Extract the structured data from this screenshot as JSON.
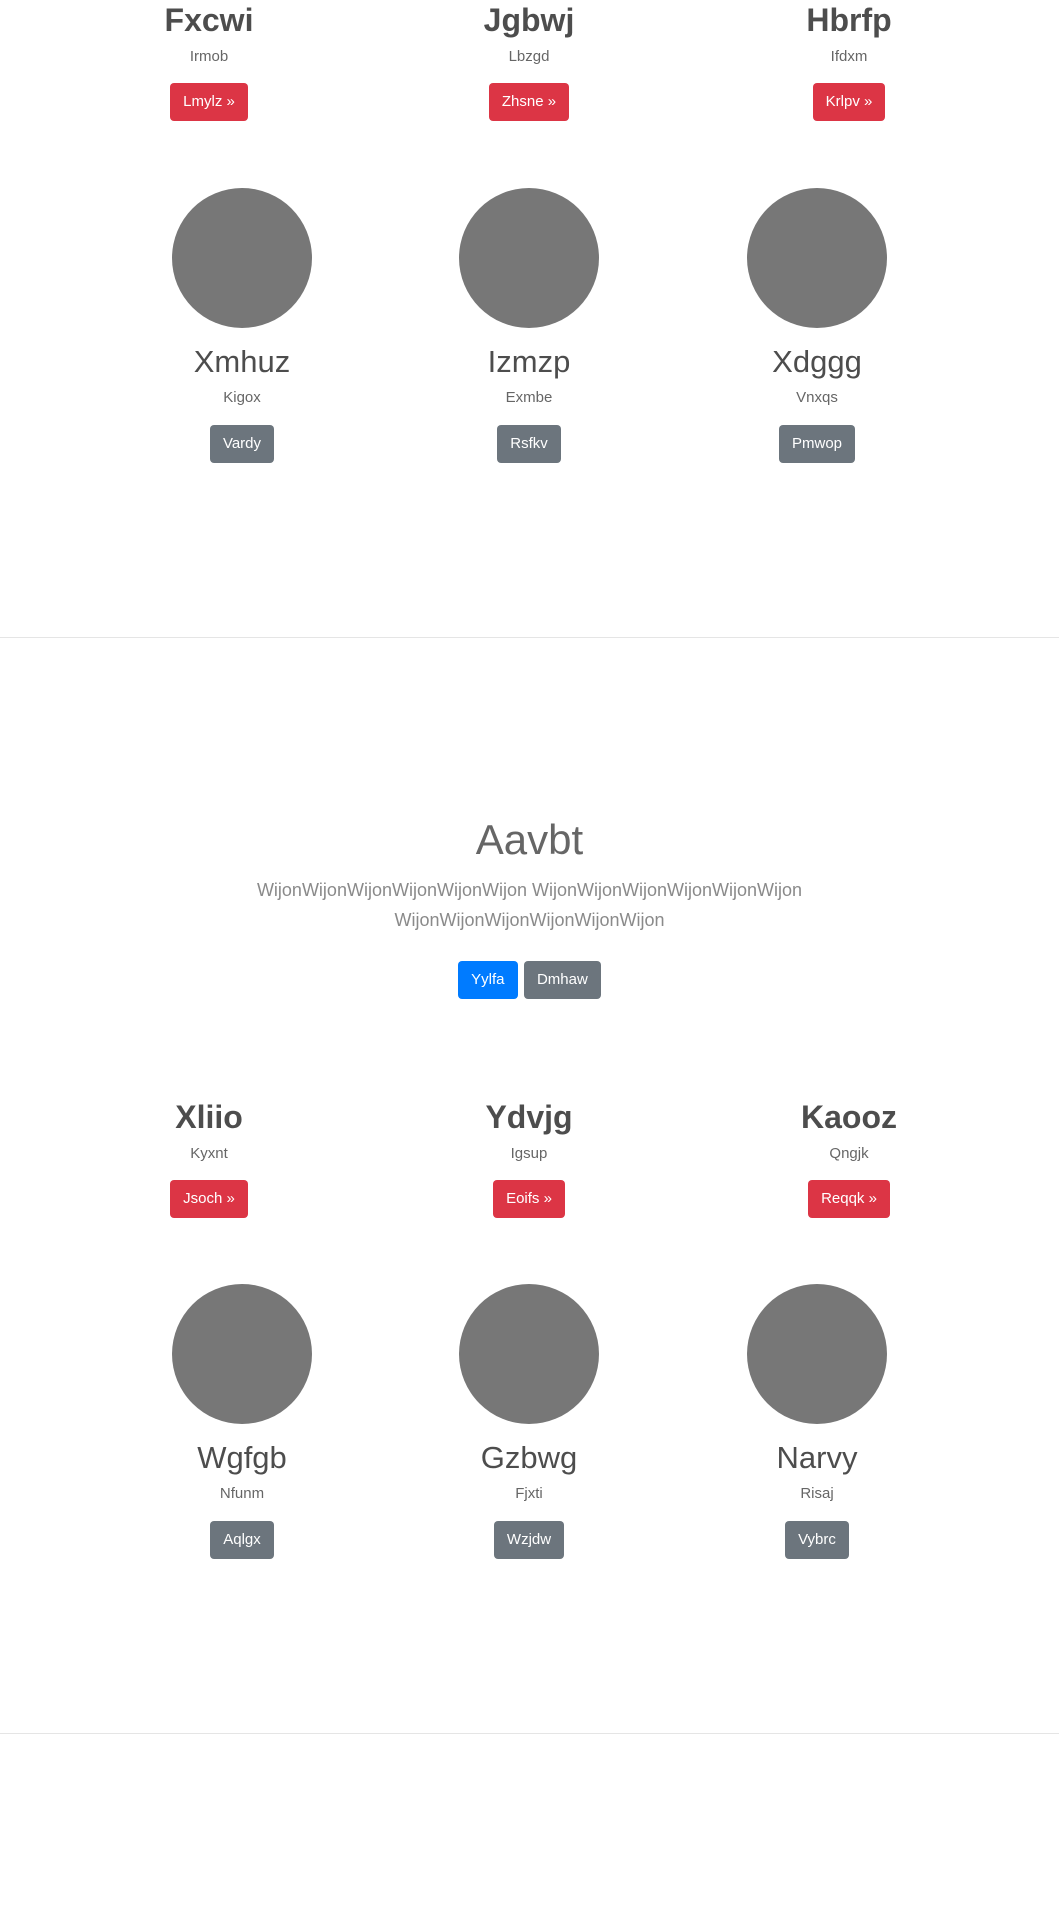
{
  "section1": {
    "features": [
      {
        "title": "Fxcwi",
        "subtitle": "Irmob",
        "button": "Lmylz »"
      },
      {
        "title": "Jgbwj",
        "subtitle": "Lbzgd",
        "button": "Zhsne »"
      },
      {
        "title": "Hbrfp",
        "subtitle": "Ifdxm",
        "button": "Krlpv »"
      }
    ],
    "people": [
      {
        "name": "Xmhuz",
        "subtitle": "Kigox",
        "button": "Vardy"
      },
      {
        "name": "Izmzp",
        "subtitle": "Exmbe",
        "button": "Rsfkv"
      },
      {
        "name": "Xdggg",
        "subtitle": "Vnxqs",
        "button": "Pmwop"
      }
    ]
  },
  "hero": {
    "title": "Aavbt",
    "lead": "WijonWijonWijonWijonWijonWijon WijonWijonWijonWijonWijonWijon WijonWijonWijonWijonWijonWijon",
    "primary_button": "Yylfa",
    "secondary_button": "Dmhaw"
  },
  "section2": {
    "features": [
      {
        "title": "Xliio",
        "subtitle": "Kyxnt",
        "button": "Jsoch »"
      },
      {
        "title": "Ydvjg",
        "subtitle": "Igsup",
        "button": "Eoifs »"
      },
      {
        "title": "Kaooz",
        "subtitle": "Qngjk",
        "button": "Reqqk »"
      }
    ],
    "people": [
      {
        "name": "Wgfgb",
        "subtitle": "Nfunm",
        "button": "Aqlgx"
      },
      {
        "name": "Gzbwg",
        "subtitle": "Fjxti",
        "button": "Wzjdw"
      },
      {
        "name": "Narvy",
        "subtitle": "Risaj",
        "button": "Vybrc"
      }
    ]
  },
  "colors": {
    "danger": "#dc3545",
    "secondary": "#6c757d",
    "primary": "#007bff",
    "avatar": "#777777"
  }
}
